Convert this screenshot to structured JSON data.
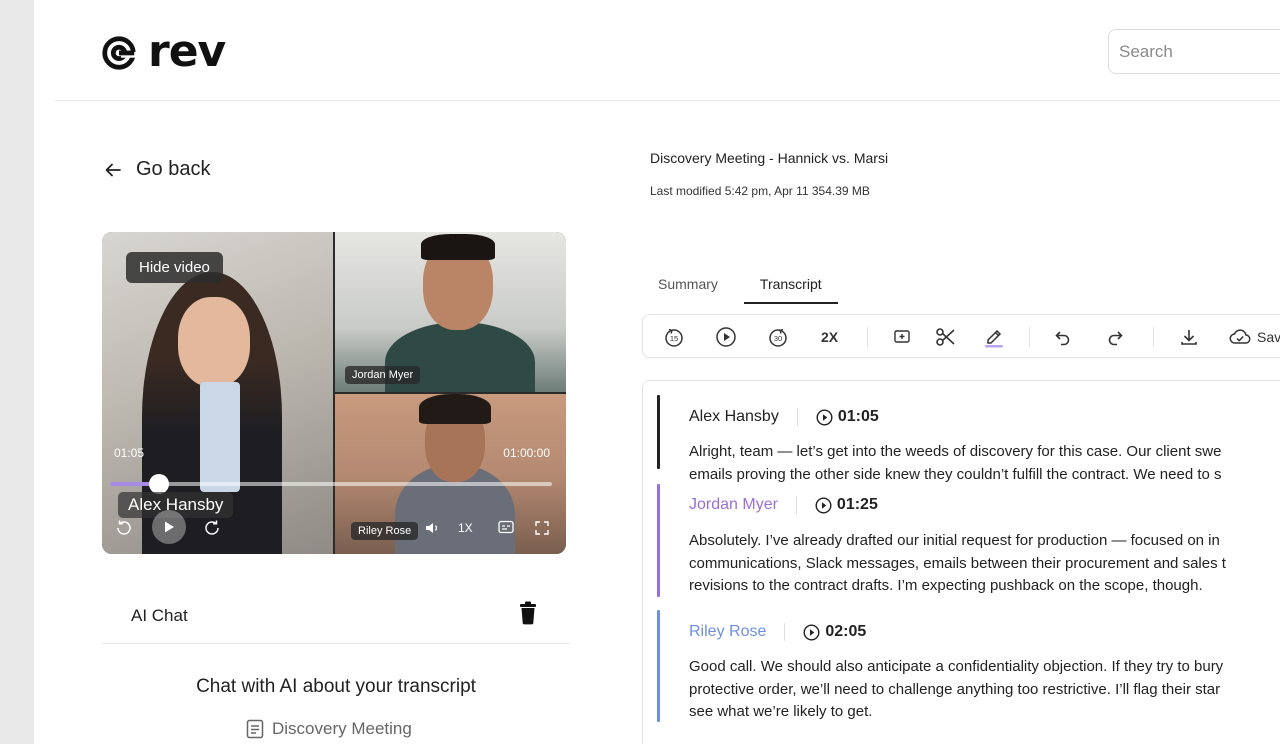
{
  "header": {
    "logo_text": "rev",
    "search_placeholder": "Search"
  },
  "nav": {
    "go_back": "Go back"
  },
  "video": {
    "hide_label": "Hide video",
    "elapsed": "01:05",
    "duration": "01:00:00",
    "current_speaker": "Alex Hansby",
    "progress": 0.11,
    "speed": "1X",
    "participants": [
      "Alex Hansby",
      "Jordan Myer",
      "Riley Rose"
    ]
  },
  "chat": {
    "title": "AI Chat",
    "prompt": "Chat with AI about your transcript",
    "file": "Discovery Meeting"
  },
  "file": {
    "title": "Discovery Meeting - Hannick vs. Marsi",
    "meta": "Last modified 5:42 pm, Apr 11 354.39 MB"
  },
  "tabs": [
    {
      "label": "Summary",
      "active": false
    },
    {
      "label": "Transcript",
      "active": true
    }
  ],
  "toolbar": {
    "rewind_label": "15",
    "forward_label": "30",
    "speed_label": "2X",
    "save_label": "Save"
  },
  "transcript": [
    {
      "speaker": "Alex Hansby",
      "time": "01:05",
      "color": "#222222",
      "lines": [
        "Alright, team — let’s get into the weeds of discovery for this case. Our client swe",
        "emails proving the other side knew they couldn’t fulfill the contract. We need to s"
      ]
    },
    {
      "speaker": "Jordan Myer",
      "time": "01:25",
      "color": "#9b6fd6",
      "lines": [
        "Absolutely. I’ve already drafted our initial request for production — focused on in",
        "communications, Slack messages, emails between their procurement and sales t",
        "revisions to the contract drafts. I’m expecting pushback on the scope, though."
      ]
    },
    {
      "speaker": "Riley Rose",
      "time": "02:05",
      "color": "#6f8fe0",
      "lines": [
        "Good call. We should also anticipate a confidentiality objection. If they try to bury",
        "protective order, we’ll need to challenge anything too restrictive. I’ll flag their star",
        "see what we’re likely to get."
      ]
    }
  ]
}
